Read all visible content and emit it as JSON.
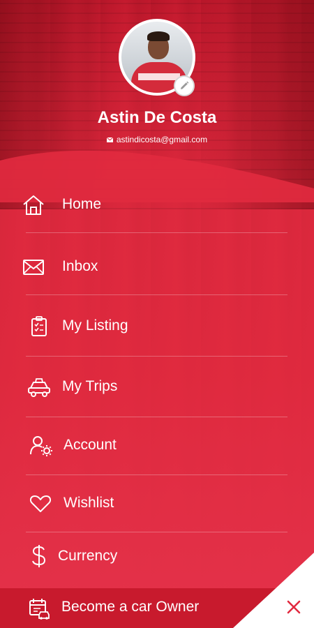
{
  "profile": {
    "name": "Astin De Costa",
    "email": "astindicosta@gmail.com",
    "avatar_icon": "user-avatar",
    "edit_icon": "pencil-icon"
  },
  "menu": {
    "items": [
      {
        "label": "Home",
        "icon": "home-icon"
      },
      {
        "label": "Inbox",
        "icon": "envelope-icon"
      },
      {
        "label": "My Listing",
        "icon": "clipboard-check-icon"
      },
      {
        "label": "My Trips",
        "icon": "car-icon"
      },
      {
        "label": "Account",
        "icon": "user-gear-icon"
      },
      {
        "label": "Wishlist",
        "icon": "heart-icon"
      },
      {
        "label": "Currency",
        "icon": "dollar-icon"
      }
    ],
    "footer_item": {
      "label": "Become a car Owner",
      "icon": "calendar-car-icon"
    },
    "close_icon": "close-icon"
  },
  "colors": {
    "primary": "#e12a3f",
    "footer": "#c81a2d",
    "close": "#e12a3f",
    "text": "#ffffff"
  }
}
